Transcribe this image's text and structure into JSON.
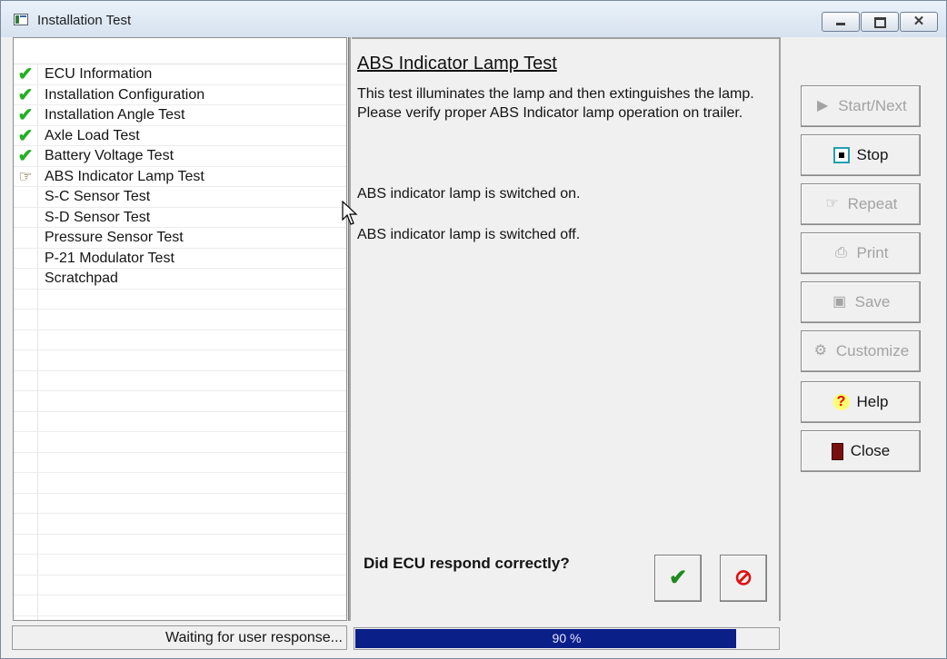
{
  "window": {
    "title": "Installation Test"
  },
  "tests": [
    {
      "label": "ECU Information",
      "status": "passed"
    },
    {
      "label": "Installation Configuration",
      "status": "passed"
    },
    {
      "label": "Installation Angle Test",
      "status": "passed"
    },
    {
      "label": "Axle Load Test",
      "status": "passed"
    },
    {
      "label": "Battery Voltage Test",
      "status": "passed"
    },
    {
      "label": "ABS Indicator Lamp Test",
      "status": "current"
    },
    {
      "label": "S-C Sensor Test",
      "status": "pending"
    },
    {
      "label": "S-D Sensor Test",
      "status": "pending"
    },
    {
      "label": "Pressure Sensor Test",
      "status": "pending"
    },
    {
      "label": "P-21 Modulator Test",
      "status": "pending"
    },
    {
      "label": "Scratchpad",
      "status": "pending"
    }
  ],
  "main": {
    "title": "ABS Indicator Lamp Test",
    "description_line1": "This test illuminates the lamp and then extinguishes the lamp.",
    "description_line2": "Please verify proper ABS Indicator lamp operation on trailer.",
    "status_on": "ABS indicator lamp is switched on.",
    "status_off": "ABS indicator lamp is switched off.",
    "question": "Did ECU respond correctly?",
    "yes_icon": "✔",
    "no_icon": "⊘"
  },
  "buttons": {
    "start_next": "Start/Next",
    "stop": "Stop",
    "repeat": "Repeat",
    "print": "Print",
    "save": "Save",
    "customize": "Customize",
    "help": "Help",
    "close": "Close"
  },
  "statusbar": {
    "text": "Waiting for user response...",
    "progress_percent": 90,
    "progress_label": "90 %"
  },
  "colors": {
    "check": "#22b022",
    "progress": "#0b1f88",
    "no": "#e01010"
  }
}
